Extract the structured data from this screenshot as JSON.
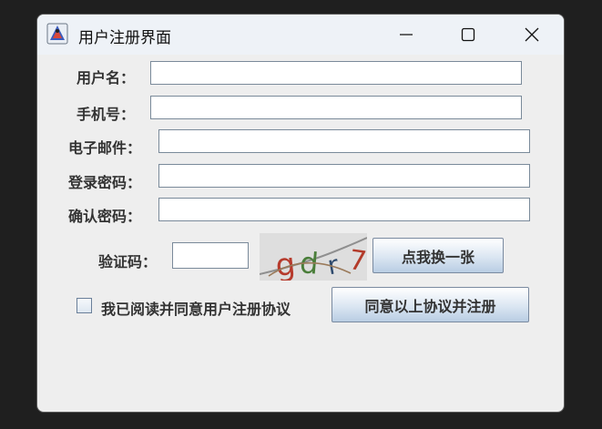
{
  "window": {
    "title": "用户注册界面"
  },
  "form": {
    "username_label": "用户名：",
    "phone_label": "手机号：",
    "email_label": "电子邮件：",
    "password_label": "登录密码：",
    "confirm_label": "确认密码：",
    "captcha_label": "验证码：",
    "username_value": "",
    "phone_value": "",
    "email_value": "",
    "password_value": "",
    "confirm_value": "",
    "captcha_value": "",
    "refresh_button": "点我换一张",
    "agree_label": "我已阅读并同意用户注册协议",
    "agree_checked": false,
    "submit_button": "同意以上协议并注册"
  },
  "captcha_image": {
    "text": "gdr7"
  },
  "colors": {
    "window_bg": "#eeeeee",
    "titlebar_bg": "#eef2f7",
    "desktop_bg": "#1f1f1f"
  }
}
